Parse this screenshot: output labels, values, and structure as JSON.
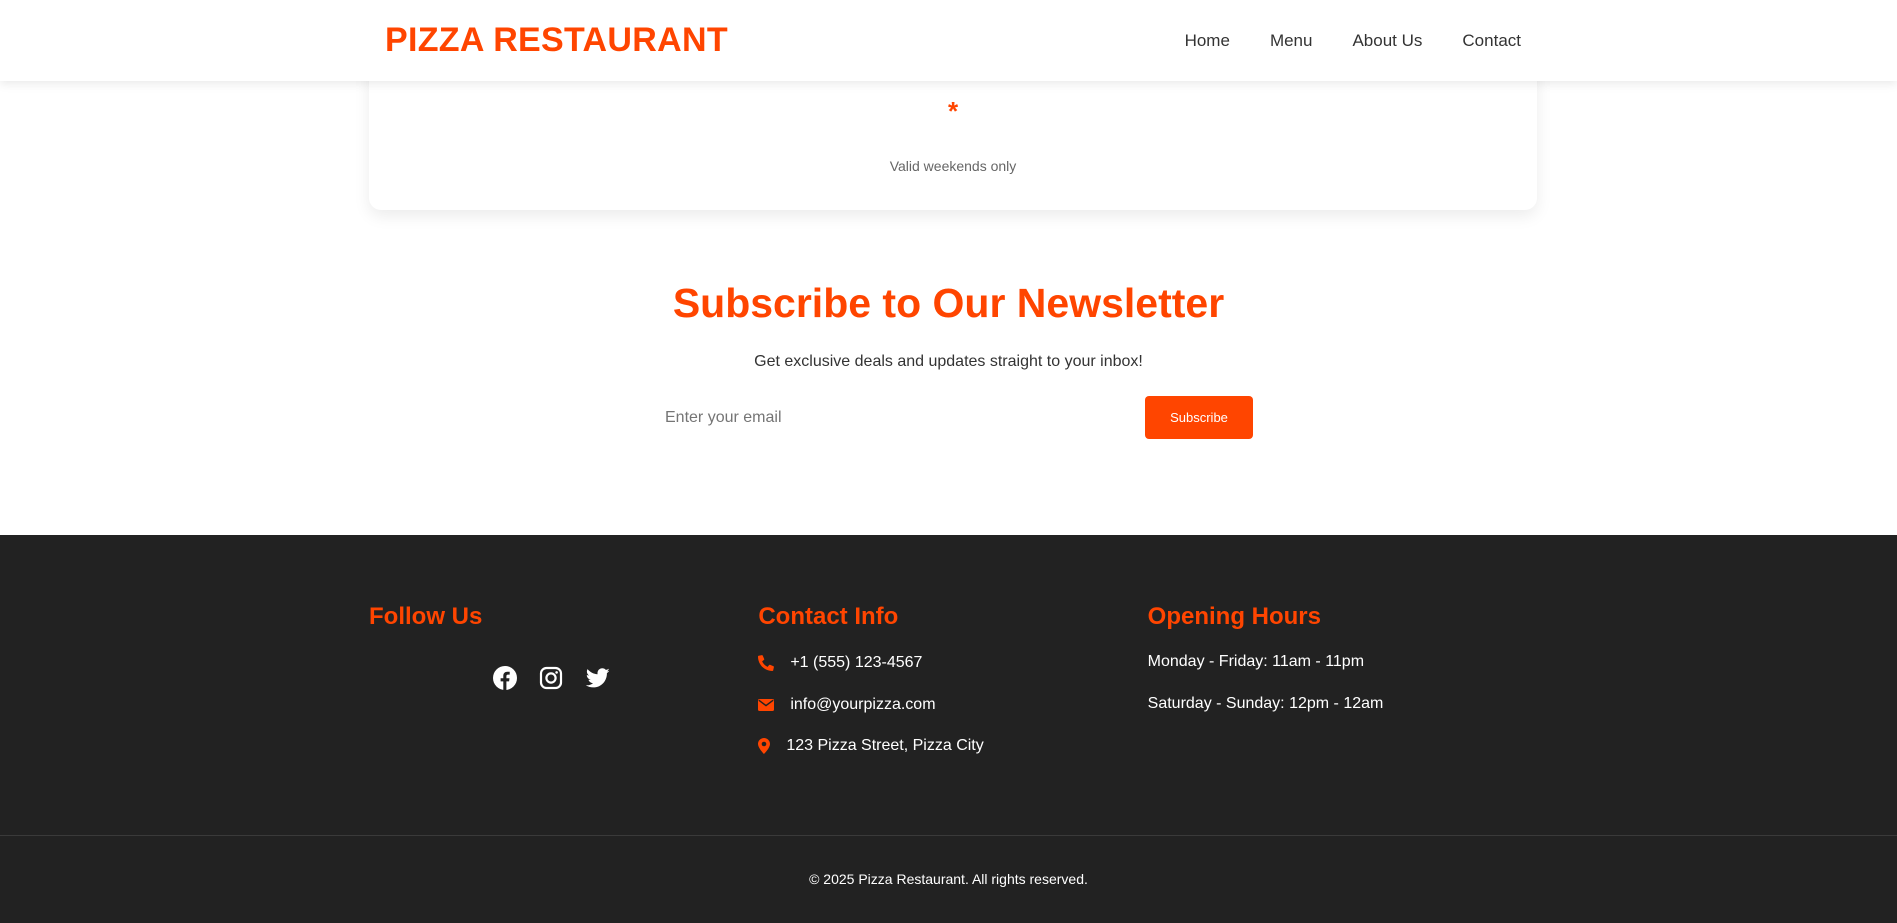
{
  "header": {
    "brand": "PIZZA RESTAURANT",
    "nav": [
      "Home",
      "Menu",
      "About Us",
      "Contact"
    ]
  },
  "offer": {
    "asterisk": "*",
    "note": "Valid weekends only"
  },
  "newsletter": {
    "title": "Subscribe to Our Newsletter",
    "subtitle": "Get exclusive deals and updates straight to your inbox!",
    "email_placeholder": "Enter your email",
    "button_label": "Subscribe"
  },
  "footer": {
    "follow": {
      "title": "Follow Us",
      "icons": [
        "facebook-icon",
        "instagram-icon",
        "twitter-icon"
      ]
    },
    "contact": {
      "title": "Contact Info",
      "phone": "+1 (555) 123-4567",
      "email": "info@yourpizza.com",
      "address": "123 Pizza Street, Pizza City"
    },
    "hours": {
      "title": "Opening Hours",
      "weekdays": "Monday - Friday: 11am - 11pm",
      "weekend": "Saturday - Sunday: 12pm - 12am"
    },
    "copyright": "© 2025 Pizza Restaurant. All rights reserved."
  },
  "colors": {
    "accent": "#ff4500",
    "footer_bg": "#222222",
    "text": "#333333"
  }
}
